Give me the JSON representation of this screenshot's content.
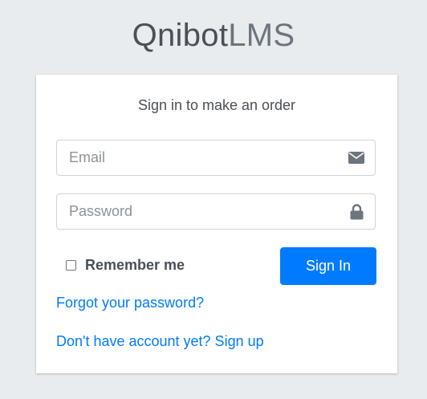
{
  "logo": {
    "bold": "Qnibot",
    "light": "LMS"
  },
  "card": {
    "message": "Sign in to make an order",
    "email": {
      "placeholder": "Email",
      "value": "",
      "icon": "envelope-icon"
    },
    "password": {
      "placeholder": "Password",
      "value": "",
      "icon": "lock-icon"
    },
    "remember_label": "Remember me",
    "remember_checked": false,
    "signin_label": "Sign In",
    "forgot_link": "Forgot your password?",
    "signup_link": "Don't have account yet? Sign up"
  },
  "colors": {
    "background": "#e9ecef",
    "primary": "#007bff",
    "text": "#495057"
  }
}
